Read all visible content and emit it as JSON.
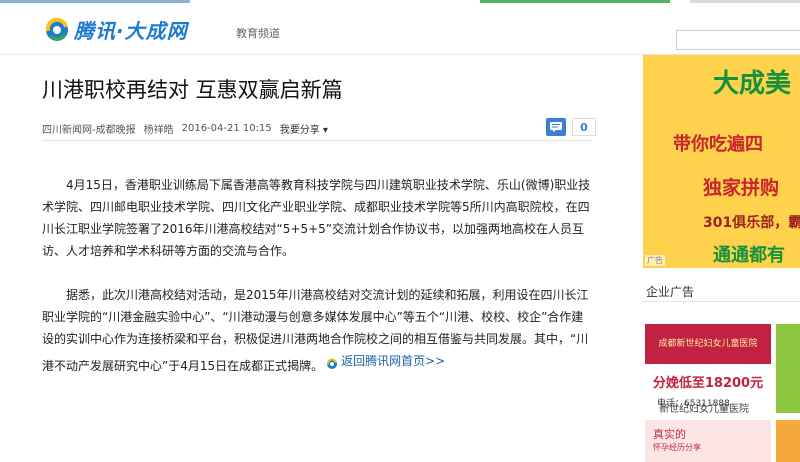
{
  "header": {
    "logo_text": "腾讯·大成网",
    "channel": "教育频道"
  },
  "article": {
    "title": "川港职校再结对 互惠双赢启新篇",
    "source": "四川新闻网-成都晚报",
    "author": "杨祥皓",
    "date": "2016-04-21 10:15",
    "share_label": "我要分享",
    "comment_count": "0",
    "paragraphs": [
      "4月15日，香港职业训练局下属香港高等教育科技学院与四川建筑职业技术学院、乐山(微博)职业技术学院、四川邮电职业技术学院、四川文化产业职业学院、成都职业技术学院等5所川内高职院校，在四川长江职业学院签署了2016年川港高校结对“5+5+5”交流计划合作协议书，以加强两地高校在人员互访、人才培养和学术科研等方面的交流与合作。",
      "据悉，此次川港高校结对活动，是2015年川港高校结对交流计划的延续和拓展，利用设在四川长江职业学院的“川港金融实验中心”、“川港动漫与创意多媒体发展中心”等五个“川港、校校、校企”合作建设的实训中心作为连接桥梁和平台，积极促进川港两地合作院校之间的相互借鉴与共同发展。其中，“川港不动产发展研究中心”于4月15日在成都正式揭牌。"
    ],
    "back_link": "返回腾讯网首页>>"
  },
  "sidebar": {
    "ad1": {
      "line1": "大成美",
      "line2": "带你吃遍四",
      "line3": "独家拼购",
      "line4": "301俱乐部，霸",
      "line5": "通通都有",
      "tag": "广告"
    },
    "section_title": "企业广告",
    "ad2": {
      "top_text": "成都新世纪妇女儿童医院",
      "price_text": "分娩低至18200元",
      "phone": "电话：65311888",
      "caption": "新世纪妇女儿童医院"
    },
    "ad3": {
      "title": "真实的",
      "subtitle": "怀孕经历分享"
    }
  },
  "colors": {
    "brand_blue": "#1f7bd1",
    "link_blue": "#1a5fa8",
    "ad_yellow": "#ffd24d",
    "ad_red": "#b9193a"
  }
}
